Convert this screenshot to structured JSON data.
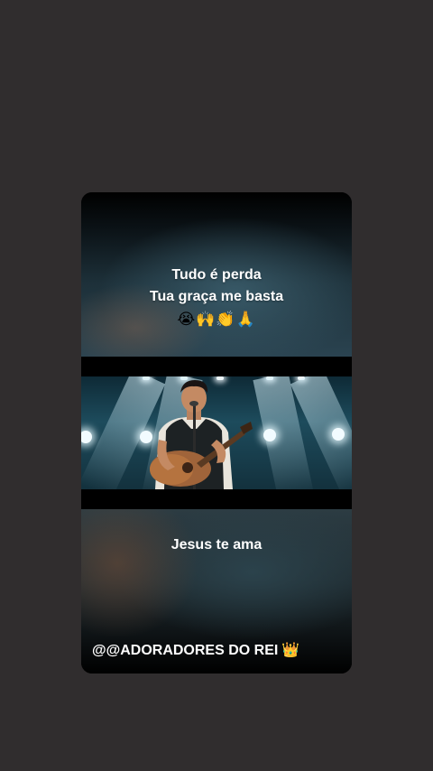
{
  "story": {
    "caption_line_1": "Tudo é perda",
    "caption_line_2": "Tua graça me basta",
    "emojis": "😭🙌👏🙏",
    "caption_bottom": "Jesus te ama",
    "handle": "@@ADORADORES DO REI",
    "handle_emoji": "👑"
  },
  "colors": {
    "background": "#302d2e",
    "text": "#ffffff"
  }
}
